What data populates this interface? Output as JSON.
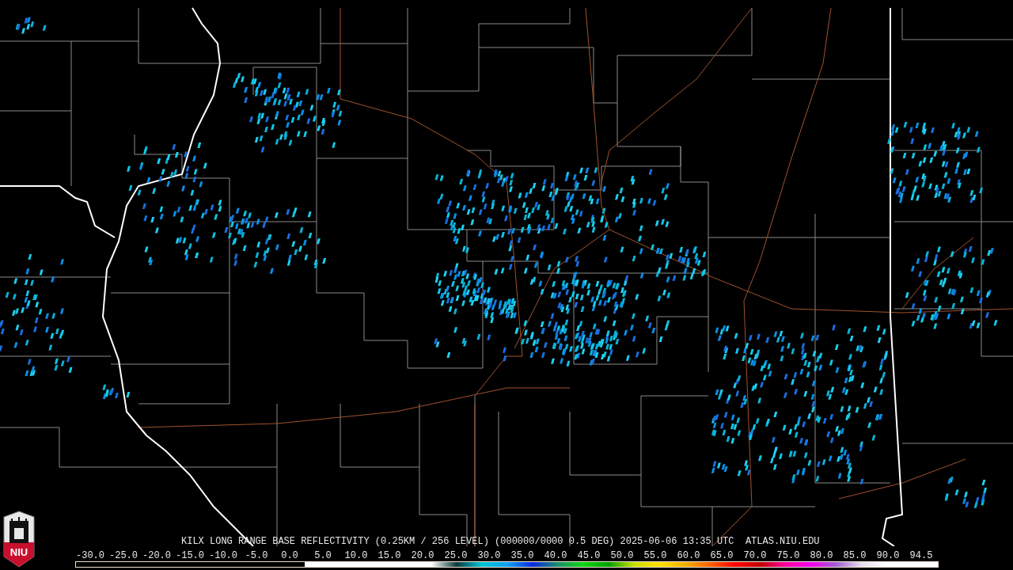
{
  "logo": {
    "text": "NIU"
  },
  "product_title": "KILX LONG RANGE BASE REFLECTIVITY (0.25KM / 256 LEVEL) (000000/0000 0.5 DEG) 2025-06-06 13:35 UTC  ATLAS.NIU.EDU",
  "legend": {
    "labels": [
      "-30.0",
      "-25.0",
      "-20.0",
      "-15.0",
      "-10.0",
      "-5.0",
      "0.0",
      "5.0",
      "10.0",
      "15.0",
      "20.0",
      "25.0",
      "30.0",
      "35.0",
      "40.0",
      "45.0",
      "50.0",
      "55.0",
      "60.0",
      "65.0",
      "70.0",
      "75.0",
      "80.0",
      "85.0",
      "90.0",
      "94.5"
    ]
  }
}
